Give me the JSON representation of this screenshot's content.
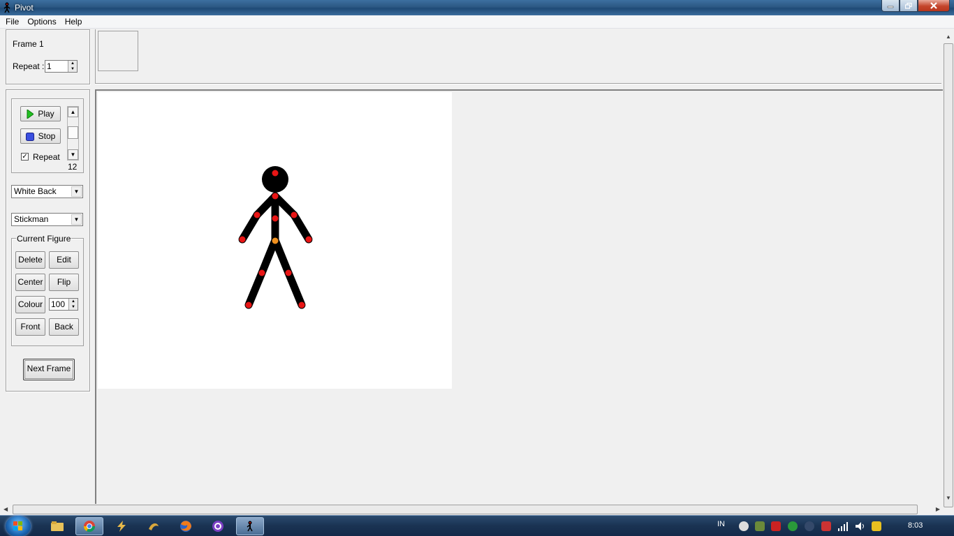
{
  "window": {
    "title": "Pivot"
  },
  "menu": {
    "items": [
      "File",
      "Options",
      "Help"
    ]
  },
  "frame_panel": {
    "frame_label": "Frame 1",
    "repeat_label": "Repeat :",
    "repeat_value": "1"
  },
  "playback": {
    "play_label": "Play",
    "stop_label": "Stop",
    "repeat_label": "Repeat",
    "repeat_checked": true,
    "speed_value": "12"
  },
  "background_select": {
    "value": "White Back"
  },
  "figure_type_select": {
    "value": "Stickman"
  },
  "current_figure": {
    "legend": "Current Figure",
    "delete_label": "Delete",
    "edit_label": "Edit",
    "center_label": "Center",
    "flip_label": "Flip",
    "colour_label": "Colour",
    "colour_value": "100",
    "front_label": "Front",
    "back_label": "Back"
  },
  "next_frame_label": "Next Frame",
  "taskbar": {
    "language": "IN",
    "clock": "8:03"
  },
  "colors": {
    "joint": "#e81515",
    "origin_joint": "#f0901e",
    "figure": "#000000",
    "canvas": "#ffffff"
  }
}
